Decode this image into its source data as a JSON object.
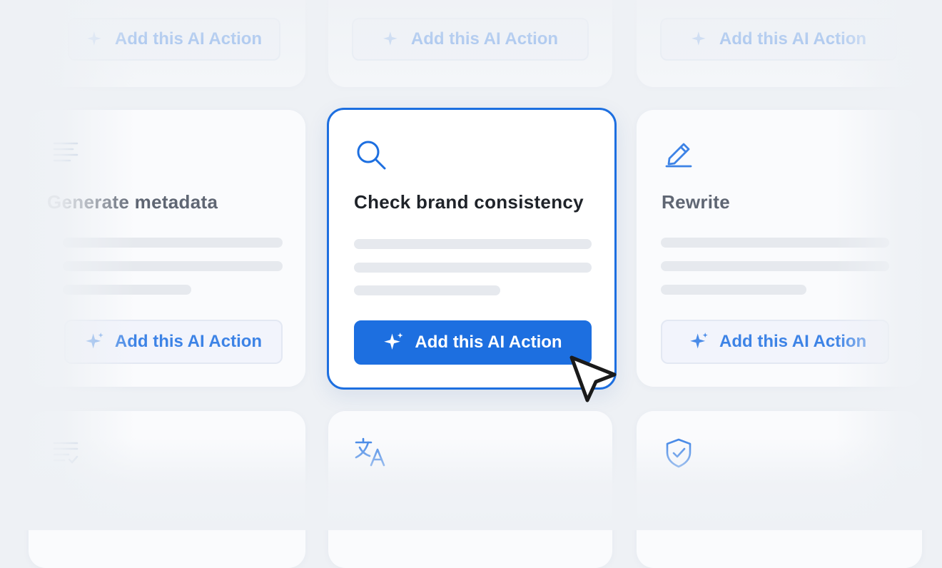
{
  "colors": {
    "accent": "#1d6fe0",
    "background": "#eef1f5",
    "card": "#fafbfd"
  },
  "top_row": [
    {
      "button_label": "Add this AI Action"
    },
    {
      "button_label": "Add this AI Action"
    },
    {
      "button_label": "Add this AI Action"
    }
  ],
  "middle_row": [
    {
      "icon": "lines-icon",
      "title": "Generate metadata",
      "button_label": "Add this AI Action"
    },
    {
      "icon": "search-icon",
      "title": "Check brand consistency",
      "button_label": "Add this AI Action"
    },
    {
      "icon": "pencil-icon",
      "title": "Rewrite",
      "button_label": "Add this AI Action"
    }
  ],
  "bottom_row": [
    {
      "icon": "checklist-icon"
    },
    {
      "icon": "translate-icon"
    },
    {
      "icon": "shield-check-icon"
    }
  ]
}
